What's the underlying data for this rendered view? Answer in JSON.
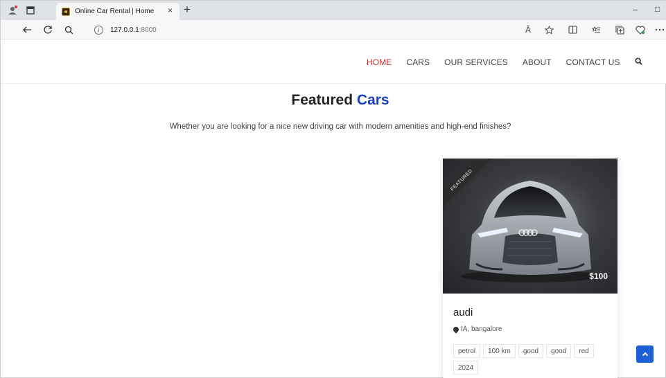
{
  "browser": {
    "tab_title": "Online Car Rental | Home",
    "tab_close": "×",
    "new_tab": "+",
    "url_host": "127.0.0.1",
    "url_port": ":8000",
    "info_glyph": "i",
    "read_aloud": "Â",
    "minimize": "–",
    "maximize": "□"
  },
  "menu": {
    "items": [
      {
        "label": "HOME",
        "active": true
      },
      {
        "label": "CARS",
        "active": false
      },
      {
        "label": "OUR SERVICES",
        "active": false
      },
      {
        "label": "ABOUT",
        "active": false
      },
      {
        "label": "CONTACT US",
        "active": false
      }
    ]
  },
  "featured": {
    "title_main": "Featured",
    "title_accent": "Cars",
    "subtitle": "Whether you are looking for a nice new driving car with modern amenities and high-end finishes?"
  },
  "car": {
    "ribbon": "FEATURED",
    "price": "$100",
    "name": "audi",
    "location": "IA, bangalore",
    "tags": [
      "petrol",
      "100 km",
      "good",
      "good",
      "red",
      "2024"
    ]
  },
  "colors": {
    "accent_blue": "#1a3fc7",
    "active_red": "#d22b2b",
    "to_top_blue": "#1d5fd6"
  }
}
